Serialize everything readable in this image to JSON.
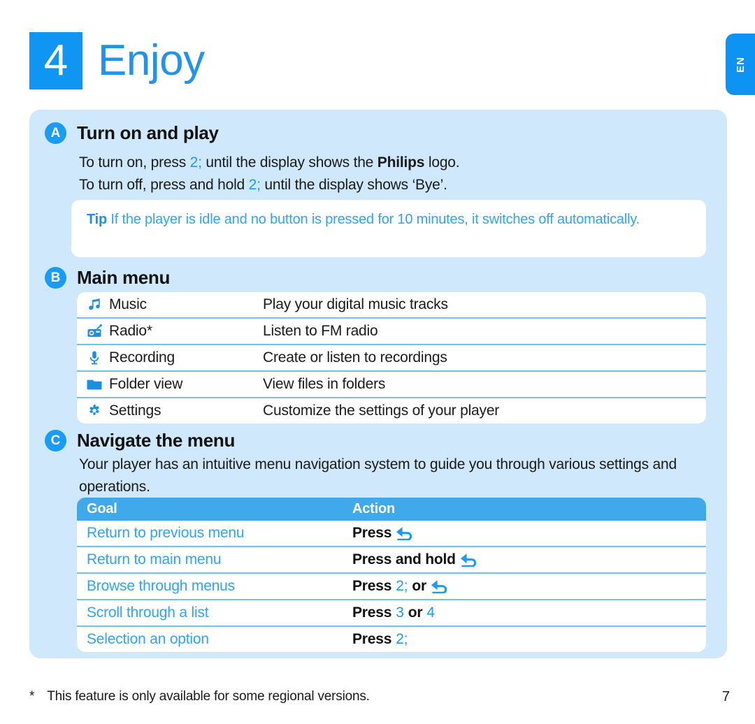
{
  "header": {
    "chapter_number": "4",
    "chapter_title": "Enjoy",
    "language_tab": "EN"
  },
  "sections": {
    "a": {
      "badge": "A",
      "title": "Turn on and play",
      "line1_pre": "To turn on, press ",
      "line1_key": "2;",
      "line1_mid": " until the display shows the ",
      "line1_bold": "Philips",
      "line1_post": " logo.",
      "line2_pre": "To turn off, press and hold ",
      "line2_key": "2;",
      "line2_post": " until the display shows ‘Bye’."
    },
    "tip": {
      "label": "Tip",
      "text": " If the player is idle and no button is pressed for 10 minutes, it switches off automatically."
    },
    "b": {
      "badge": "B",
      "title": "Main menu",
      "rows": [
        {
          "icon": "music-note-icon",
          "label": "Music",
          "description": "Play your digital music tracks"
        },
        {
          "icon": "radio-icon",
          "label": "Radio*",
          "description": "Listen to FM radio"
        },
        {
          "icon": "microphone-icon",
          "label": "Recording",
          "description": "Create or listen to recordings"
        },
        {
          "icon": "folder-icon",
          "label": "Folder view",
          "description": "View files in folders"
        },
        {
          "icon": "gear-icon",
          "label": "Settings",
          "description": "Customize the settings of your player"
        }
      ]
    },
    "c": {
      "badge": "C",
      "title": "Navigate the menu",
      "intro": "Your player has an intuitive menu navigation system to guide you through various settings and operations.",
      "table": {
        "headers": {
          "goal": "Goal",
          "action": "Action"
        },
        "rows": [
          {
            "goal": "Return to previous menu",
            "action_pre": "Press",
            "key1": "",
            "joiner": "",
            "key2": "",
            "arrow1": true,
            "arrow2": false
          },
          {
            "goal": "Return to main menu",
            "action_pre": "Press and hold",
            "key1": "",
            "joiner": "",
            "key2": "",
            "arrow1": true,
            "arrow2": false
          },
          {
            "goal": "Browse through menus",
            "action_pre": "Press",
            "key1": "2;",
            "joiner": "or",
            "key2": "",
            "arrow1": false,
            "arrow2": true
          },
          {
            "goal": "Scroll through a list",
            "action_pre": "Press",
            "key1": "3",
            "joiner": "or",
            "key2": "4",
            "arrow1": false,
            "arrow2": false
          },
          {
            "goal": "Selection an option",
            "action_pre": "Press",
            "key1": "2;",
            "joiner": "",
            "key2": "",
            "arrow1": false,
            "arrow2": false
          }
        ]
      }
    }
  },
  "footer": {
    "star": "*",
    "note": "This feature is only available for some regional versions.",
    "page_number": "7"
  },
  "colors": {
    "brand_blue": "#0f96f2",
    "panel_bg": "#cfe8fb",
    "accent_blue": "#1a9bf5",
    "table_header": "#3fa9ec",
    "rule_blue": "#6fc1f7"
  }
}
